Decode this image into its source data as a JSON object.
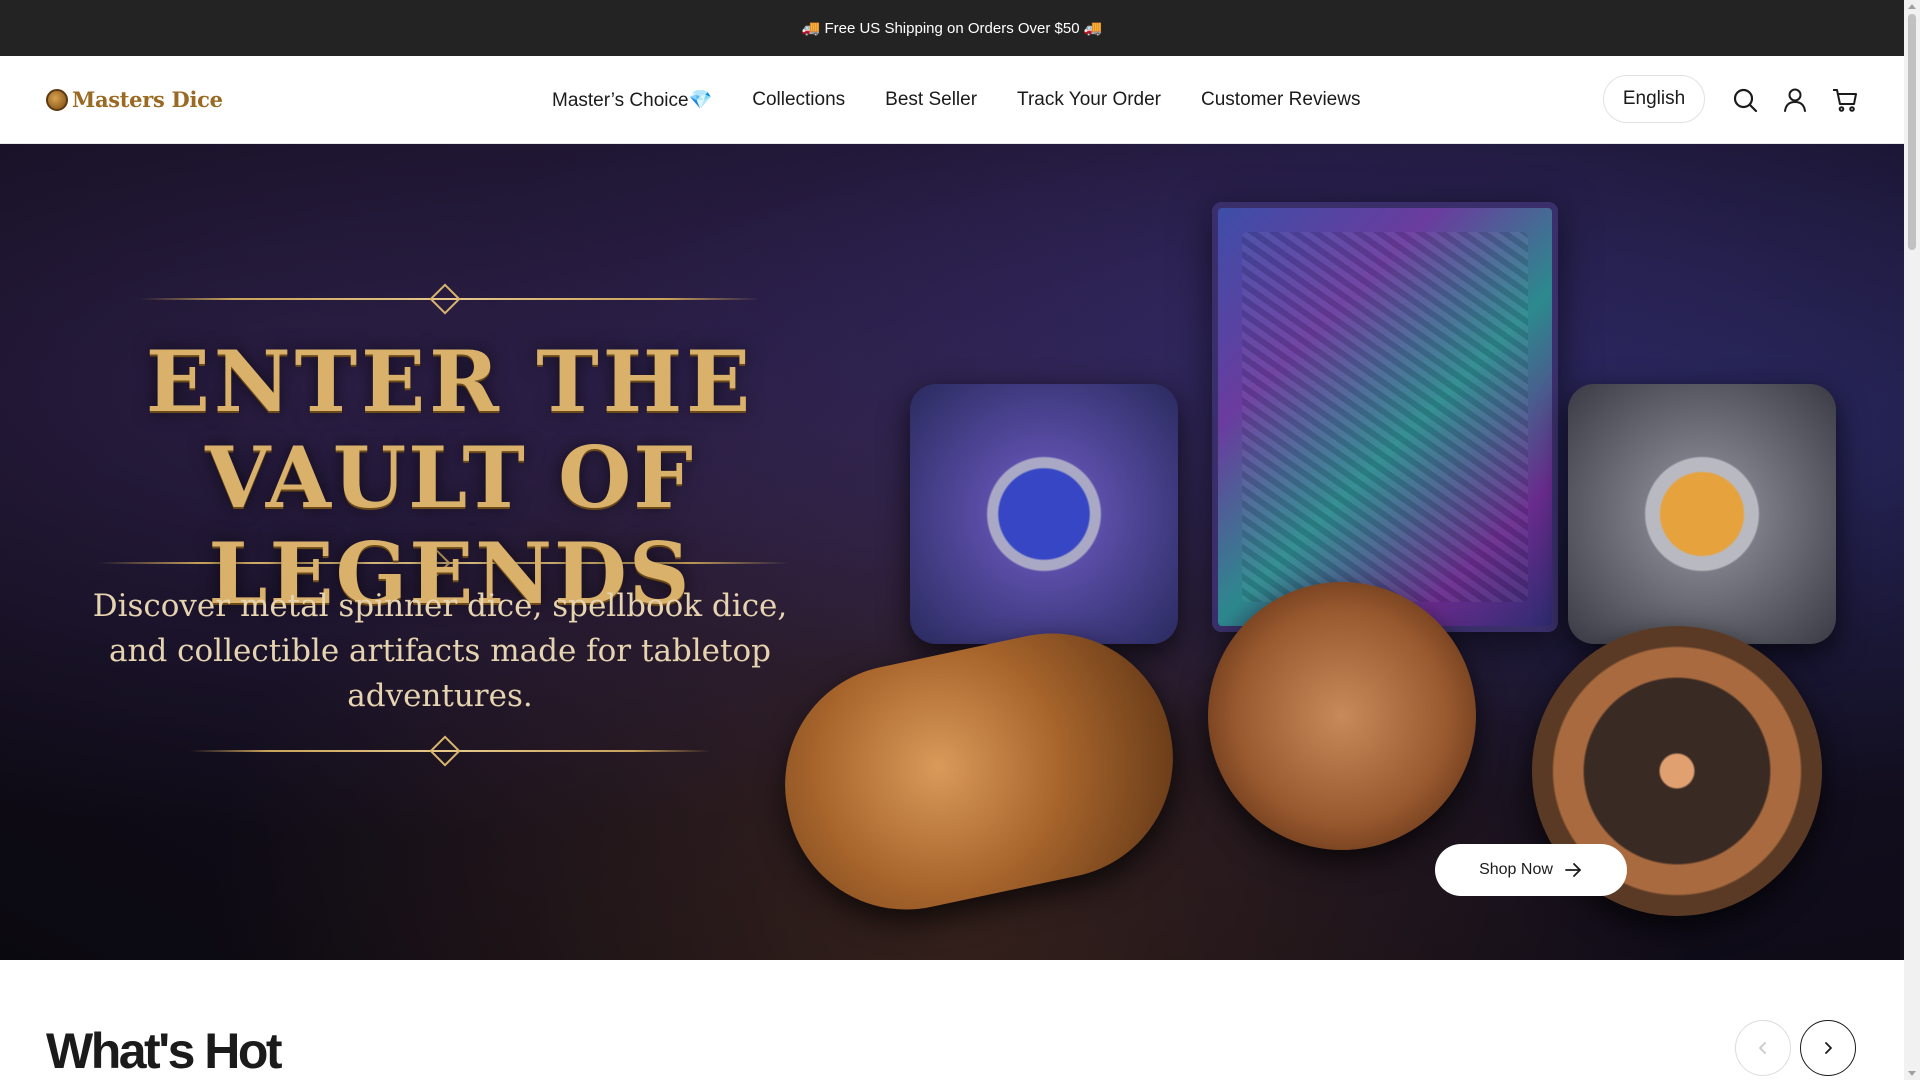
{
  "announcement": {
    "icon_left": "🚚",
    "text": "Free US Shipping on Orders Over $50",
    "icon_right": "🚚"
  },
  "header": {
    "logo_text": "Masters Dice",
    "nav": [
      {
        "label": "Master’s Choice💎"
      },
      {
        "label": "Collections"
      },
      {
        "label": "Best Seller"
      },
      {
        "label": "Track Your Order"
      },
      {
        "label": "Customer Reviews"
      }
    ],
    "language": "English",
    "icons": [
      "search-icon",
      "account-icon",
      "cart-icon"
    ]
  },
  "hero": {
    "title_line1": "ENTER THE",
    "title_line2": "VAULT OF LEGENDS",
    "subtitle": "Discover metal spinner dice, spellbook dice, and collectible artifacts made for tabletop adventures.",
    "cta_label": "Shop Now"
  },
  "section": {
    "title": "What's Hot"
  },
  "colors": {
    "announcement_bg": "#232323",
    "hero_gold": "#d9b16b",
    "text_dark": "#1b1b1b"
  }
}
